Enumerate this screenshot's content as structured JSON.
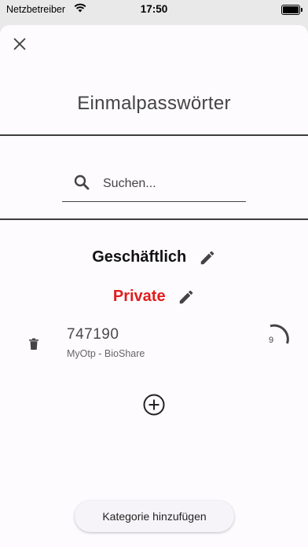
{
  "status_bar": {
    "carrier": "Netzbetreiber",
    "time": "17:50"
  },
  "header": {
    "title": "Einmalpasswörter"
  },
  "search": {
    "placeholder": "Suchen..."
  },
  "categories": [
    {
      "label": "Geschäftlich",
      "color": "#111111"
    },
    {
      "label": "Private",
      "color": "#e11d1d"
    }
  ],
  "otp_entries": [
    {
      "code": "747190",
      "issuer": "MyOtp - BioShare",
      "seconds_remaining": "9"
    }
  ],
  "footer": {
    "add_category_label": "Kategorie hinzufügen"
  },
  "colors": {
    "accent_red": "#e11d1d",
    "sheet_bg": "#fdfbfe",
    "divider": "#3d3d3d"
  },
  "icons": [
    "close-icon",
    "search-icon",
    "edit-icon",
    "trash-icon",
    "add-circle-icon",
    "wifi-icon",
    "battery-icon"
  ]
}
